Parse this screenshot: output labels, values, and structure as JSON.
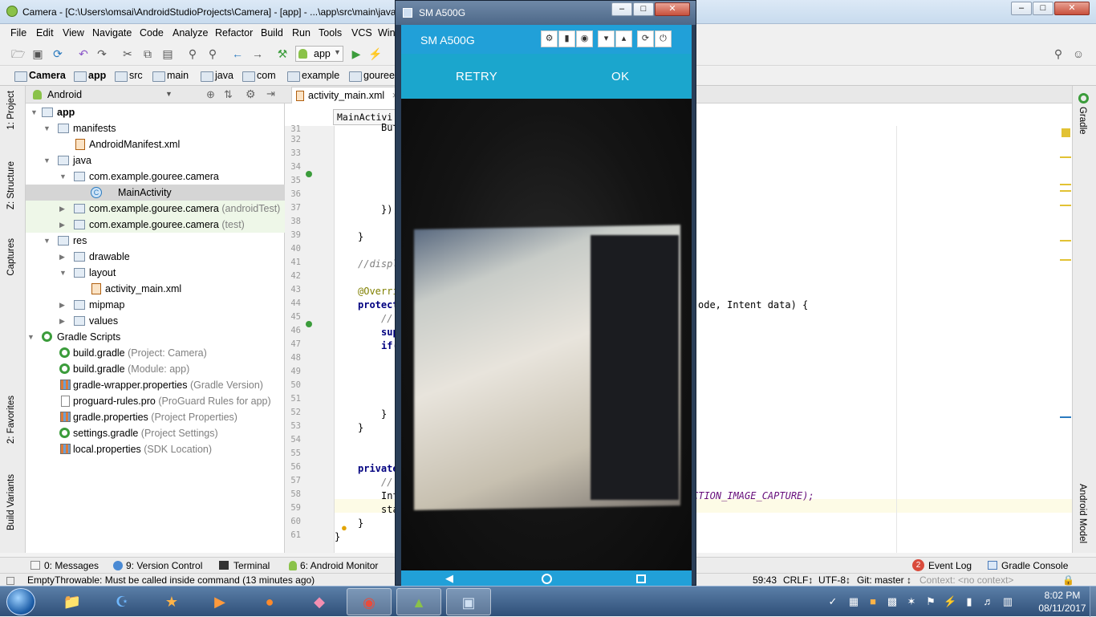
{
  "ide": {
    "title": "Camera - [C:\\Users\\omsai\\AndroidStudioProjects\\Camera] - [app] - ...\\app\\src\\main\\java",
    "menu": [
      "File",
      "Edit",
      "View",
      "Navigate",
      "Code",
      "Analyze",
      "Refactor",
      "Build",
      "Run",
      "Tools",
      "VCS",
      "Win"
    ],
    "run_config": "app",
    "breadcrumbs": [
      "Camera",
      "app",
      "src",
      "main",
      "java",
      "com",
      "example",
      "gouree"
    ],
    "left_tabs": [
      "1: Project",
      "Z: Structure",
      "Captures",
      "2: Favorites",
      "Build Variants"
    ],
    "right_tabs": [
      "Gradle",
      "Android Model"
    ],
    "project_view": "Android",
    "tree": [
      {
        "label": "app",
        "bold": true
      },
      {
        "label": "manifests"
      },
      {
        "label": "AndroidManifest.xml"
      },
      {
        "label": "java"
      },
      {
        "label": "com.example.gouree.camera"
      },
      {
        "label": "MainActivity"
      },
      {
        "label": "com.example.gouree.camera",
        "suffix": "(androidTest)"
      },
      {
        "label": "com.example.gouree.camera",
        "suffix": "(test)"
      },
      {
        "label": "res"
      },
      {
        "label": "drawable"
      },
      {
        "label": "layout"
      },
      {
        "label": "activity_main.xml"
      },
      {
        "label": "mipmap"
      },
      {
        "label": "values"
      },
      {
        "label": "Gradle Scripts"
      },
      {
        "label": "build.gradle",
        "suffix": "(Project: Camera)"
      },
      {
        "label": "build.gradle",
        "suffix": "(Module: app)"
      },
      {
        "label": "gradle-wrapper.properties",
        "suffix": "(Gradle Version)"
      },
      {
        "label": "proguard-rules.pro",
        "suffix": "(ProGuard Rules for app)"
      },
      {
        "label": "gradle.properties",
        "suffix": "(Project Properties)"
      },
      {
        "label": "settings.gradle",
        "suffix": "(Project Settings)"
      },
      {
        "label": "local.properties",
        "suffix": "(SDK Location)"
      }
    ],
    "editor_tab": "activity_main.xml",
    "editor_crumb": "MainActivi",
    "line_numbers": [
      "31",
      "32",
      "33",
      "34",
      "35",
      "36",
      "37",
      "38",
      "39",
      "40",
      "41",
      "42",
      "43",
      "44",
      "45",
      "46",
      "47",
      "48",
      "49",
      "50",
      "51",
      "52",
      "53",
      "54",
      "55",
      "56",
      "57",
      "58",
      "59",
      "60",
      "61"
    ],
    "code": {
      "l31": "Butt",
      "l37": "});",
      "l39": "}",
      "l41": "//displ",
      "l43": "@Overri",
      "l44": "protect",
      "l44_tail": "ode, Intent data) {",
      "l45": "//",
      "l46": "supe",
      "l47": "if(",
      "l52": "}",
      "l53": "}",
      "l56": "private",
      "l57": "//",
      "l58": "Int",
      "l58_tail": "CTION_IMAGE_CAPTURE);",
      "l59": "sta",
      "l60": "}",
      "l61": "}"
    },
    "bottom_tools": [
      "0: Messages",
      "9: Version Control",
      "Terminal",
      "6: Android Monitor"
    ],
    "event_log_count": "2",
    "event_log": "Event Log",
    "gradle_console": "Gradle Console",
    "status": {
      "message": "EmptyThrowable: Must be called inside command (13 minutes ago)",
      "position": "59:43",
      "line_sep": "CRLF↕",
      "encoding": "UTF-8↕",
      "git": "Git: master ↕",
      "context": "Context: <no context>"
    }
  },
  "emulator": {
    "window_title": "SM A500G",
    "device_name": "SM A500G",
    "retry_label": "RETRY",
    "ok_label": "OK"
  },
  "taskbar": {
    "time": "8:02 PM",
    "date": "08/11/2017"
  }
}
